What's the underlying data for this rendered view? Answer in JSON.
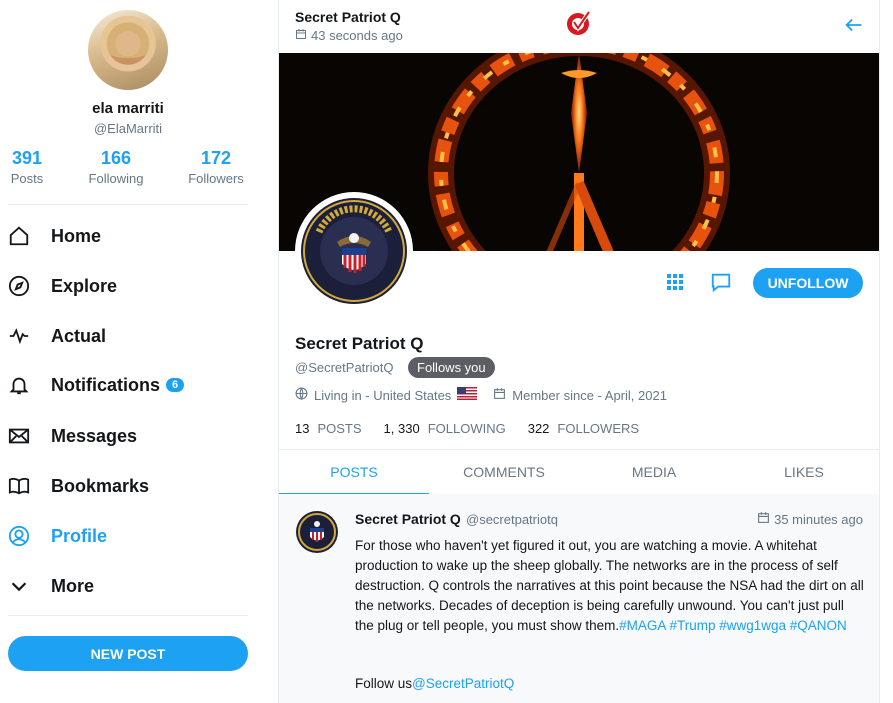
{
  "sidebar": {
    "user_name": "ela marriti",
    "user_handle": "@ElaMarriti",
    "stats": [
      {
        "num": "391",
        "label": "Posts"
      },
      {
        "num": "166",
        "label": "Following"
      },
      {
        "num": "172",
        "label": "Followers"
      }
    ],
    "nav": [
      {
        "label": "Home",
        "icon": "home-icon"
      },
      {
        "label": "Explore",
        "icon": "compass-icon"
      },
      {
        "label": "Actual",
        "icon": "activity-icon"
      },
      {
        "label": "Notifications",
        "icon": "bell-icon",
        "badge": "6"
      },
      {
        "label": "Messages",
        "icon": "envelope-icon"
      },
      {
        "label": "Bookmarks",
        "icon": "book-icon"
      },
      {
        "label": "Profile",
        "icon": "user-icon",
        "active": true
      },
      {
        "label": "More",
        "icon": "chevron-down-icon"
      }
    ],
    "new_post_label": "NEW POST"
  },
  "topbar": {
    "title": "Secret Patriot Q",
    "time": "43 seconds ago"
  },
  "profile": {
    "name": "Secret Patriot Q",
    "handle": "@SecretPatriotQ",
    "follows_you": "Follows you",
    "location": "Living in - United States",
    "member_since": "Member since - April, 2021",
    "counts": [
      {
        "num": "13",
        "label": "POSTS"
      },
      {
        "num": "1, 330",
        "label": "FOLLOWING"
      },
      {
        "num": "322",
        "label": "FOLLOWERS"
      }
    ],
    "unfollow_label": "UNFOLLOW",
    "seal_text": "DEFENSE CLANDESTINE SERVICE"
  },
  "tabs": [
    "POSTS",
    "COMMENTS",
    "MEDIA",
    "LIKES"
  ],
  "post": {
    "author": "Secret Patriot Q",
    "handle": "@secretpatriotq",
    "time": "35 minutes ago",
    "body": "For those who haven't yet figured it out, you are watching a movie. A whitehat production to wake up the sheep globally. The networks are in the process of self destruction. Q controls the narratives at this point because the NSA had the dirt on all the networks. Decades of deception is being carefully unwound. You can't just pull the plug or tell people, you must show them.",
    "hashtags": [
      "#MAGA",
      "#Trump",
      "#wwg1wga",
      "#QANON"
    ],
    "follow_prefix": "Follow us",
    "follow_link": "@SecretPatriotQ"
  },
  "colors": {
    "accent": "#1da1f2",
    "text": "#14171a",
    "muted": "#657786"
  }
}
